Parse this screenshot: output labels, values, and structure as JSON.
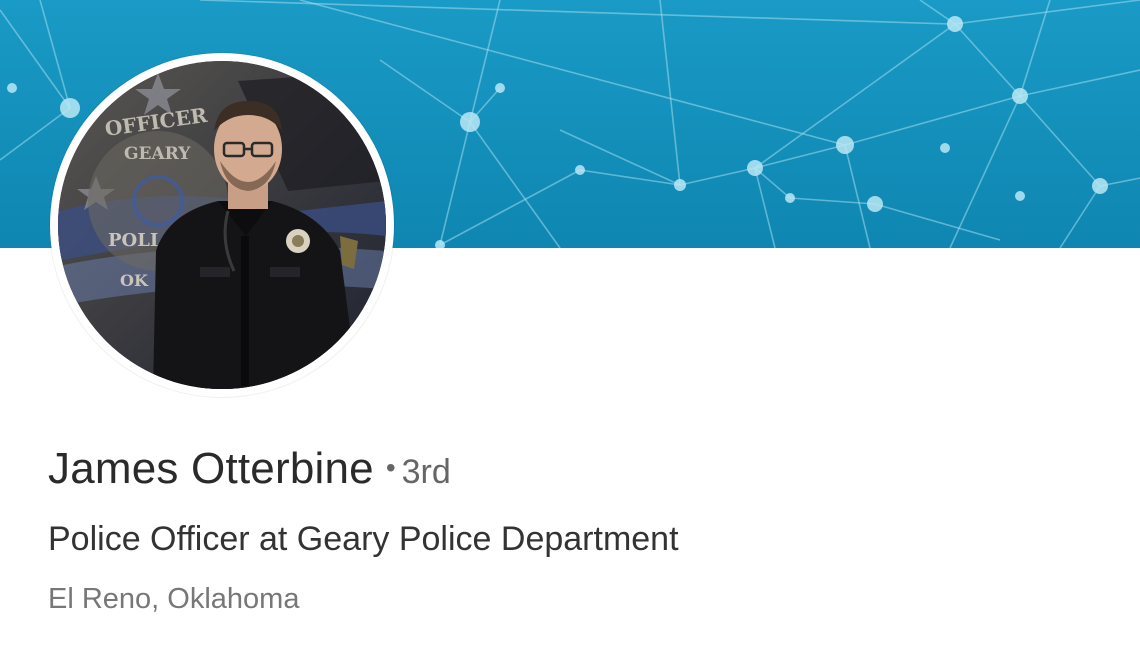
{
  "profile": {
    "name": "James Otterbine",
    "connection_separator": "•",
    "connection_degree": "3rd",
    "headline": "Police Officer at Geary Police Department",
    "location": "El Reno, Oklahoma",
    "photo_icon": "profile-photo-police-officer"
  },
  "colors": {
    "banner": "#138fba",
    "banner_network_lines": "#8fd3ea",
    "name_text": "#2a2a2a",
    "secondary_text": "#777777"
  }
}
